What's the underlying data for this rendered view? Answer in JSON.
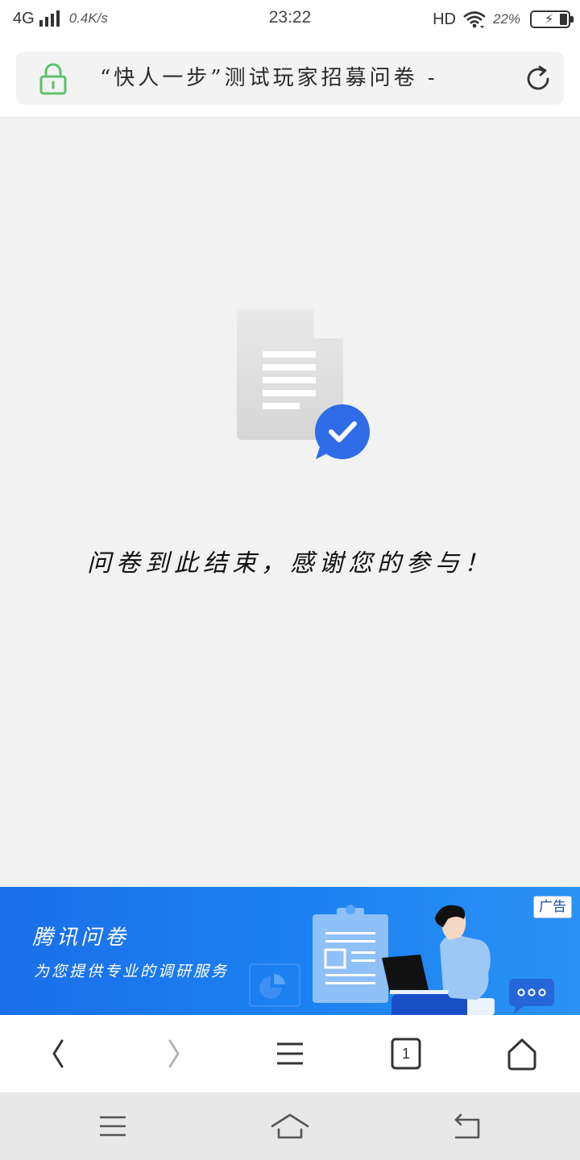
{
  "status_bar": {
    "network": "4G",
    "speed": "0.4K/s",
    "time": "23:22",
    "hd_label": "HD",
    "battery_percent": "22%",
    "battery_level": 0.22
  },
  "address_bar": {
    "title": "“快人一步”测试玩家招募问卷 -",
    "lock_color": "#5cc26a"
  },
  "content": {
    "end_message": "问卷到此结束，感谢您的参与！",
    "accent_color": "#2f6be6"
  },
  "ad": {
    "brand": "腾讯问卷",
    "slogan": "为您提供专业的调研服务",
    "badge": "广告"
  },
  "toolbar": {
    "tab_count": "1",
    "icons": [
      "back-icon",
      "forward-icon",
      "menu-icon",
      "tabs-icon",
      "home-icon"
    ]
  },
  "system_nav": {
    "icons": [
      "recent-apps-icon",
      "home-icon",
      "back-icon"
    ]
  }
}
